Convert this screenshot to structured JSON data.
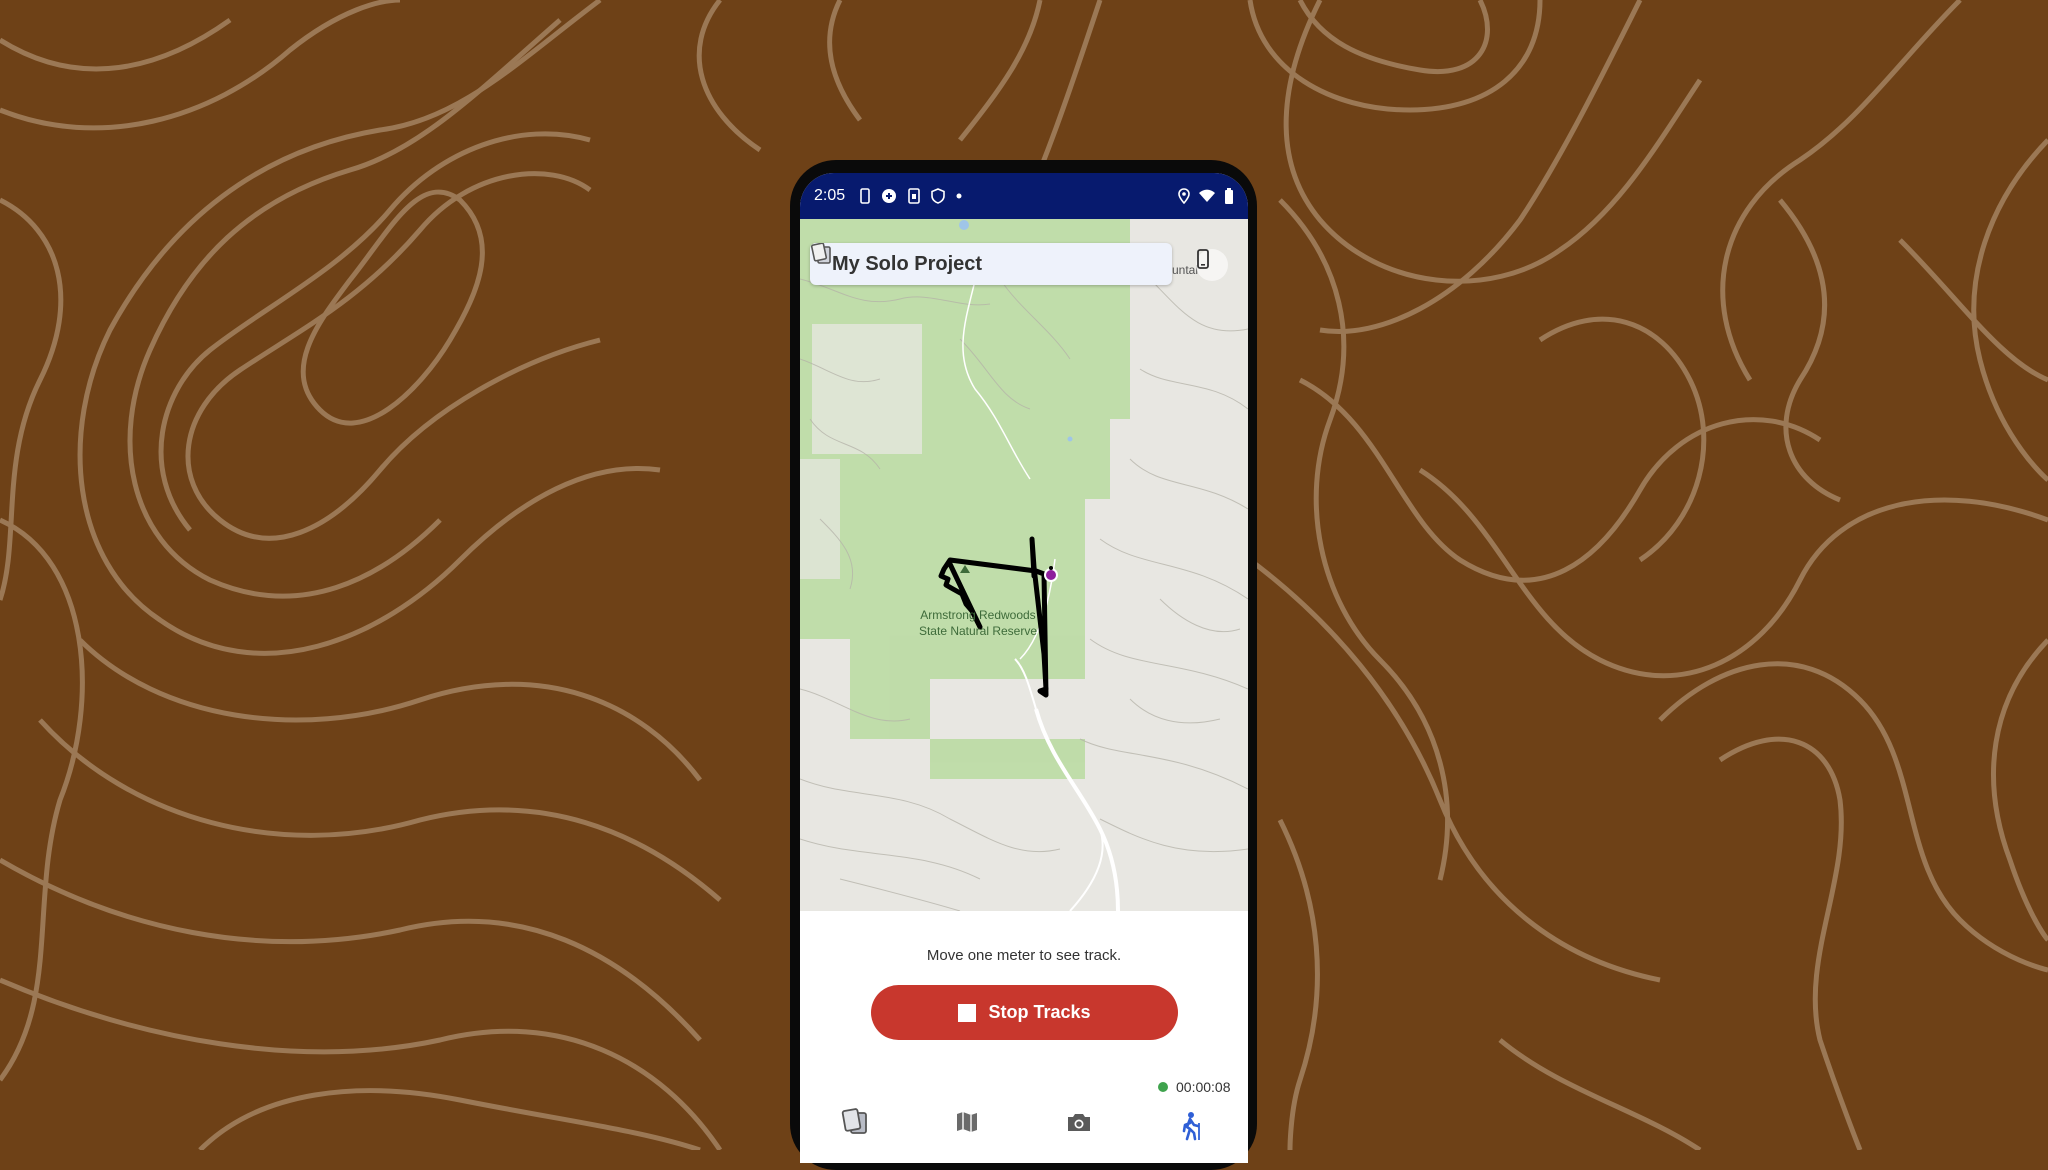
{
  "colors": {
    "background": "#6e4117",
    "status_bar": "#071a6e",
    "stop_button": "#c8372d",
    "track": "#000000",
    "location_dot": "#8e1f9c",
    "recording_dot": "#3fa34d"
  },
  "status_bar": {
    "time": "2:05",
    "icons": [
      "phone-icon",
      "settings-icon",
      "sim-icon",
      "shield-icon",
      "dot-icon",
      "location-icon",
      "wifi-icon",
      "battery-icon"
    ]
  },
  "header": {
    "project_title": "My Solo Project",
    "left_icon": "projects-icon",
    "right_icon": "device-icon"
  },
  "map": {
    "place_label_line1": "Armstrong Redwoods",
    "place_label_line2": "State Natural Reserve",
    "partial_label": "untai"
  },
  "panel": {
    "hint": "Move one meter to see track.",
    "stop_button_label": "Stop Tracks"
  },
  "nav": {
    "items": [
      "projects-icon",
      "map-icon",
      "camera-icon",
      "hiking-icon"
    ],
    "timer": "00:00:08"
  }
}
